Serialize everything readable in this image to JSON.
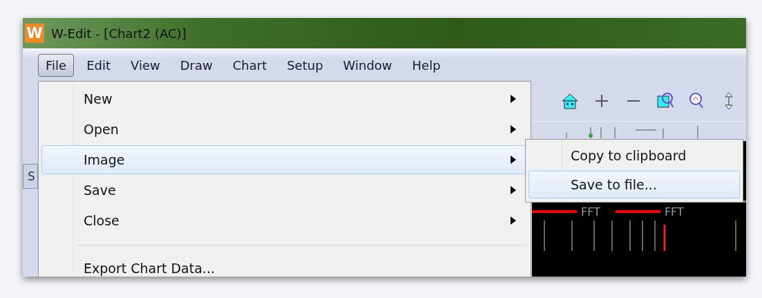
{
  "window": {
    "title": "W-Edit - [Chart2 (AC)]",
    "logo": "W"
  },
  "menubar": [
    {
      "label": "File",
      "selected": true
    },
    {
      "label": "Edit",
      "selected": false
    },
    {
      "label": "View",
      "selected": false
    },
    {
      "label": "Draw",
      "selected": false
    },
    {
      "label": "Chart",
      "selected": false
    },
    {
      "label": "Setup",
      "selected": false
    },
    {
      "label": "Window",
      "selected": false
    },
    {
      "label": "Help",
      "selected": false
    }
  ],
  "side_tab": "S",
  "file_menu": [
    {
      "kind": "item",
      "label": "New",
      "submenu": true,
      "selected": false
    },
    {
      "kind": "item",
      "label": "Open",
      "submenu": true,
      "selected": false
    },
    {
      "kind": "item",
      "label": "Image",
      "submenu": true,
      "selected": true
    },
    {
      "kind": "item",
      "label": "Save",
      "submenu": true,
      "selected": false
    },
    {
      "kind": "item",
      "label": "Close",
      "submenu": true,
      "selected": false
    },
    {
      "kind": "separator"
    },
    {
      "kind": "item",
      "label": "Export Chart Data...",
      "submenu": false,
      "selected": false
    }
  ],
  "image_submenu": [
    {
      "label": "Copy to clipboard",
      "selected": false
    },
    {
      "label": "Save to file...",
      "selected": true
    }
  ],
  "chart_legend": [
    {
      "label": "FFT",
      "color": "#ff0000"
    },
    {
      "label": "FFT",
      "color": "#ff0000"
    }
  ]
}
